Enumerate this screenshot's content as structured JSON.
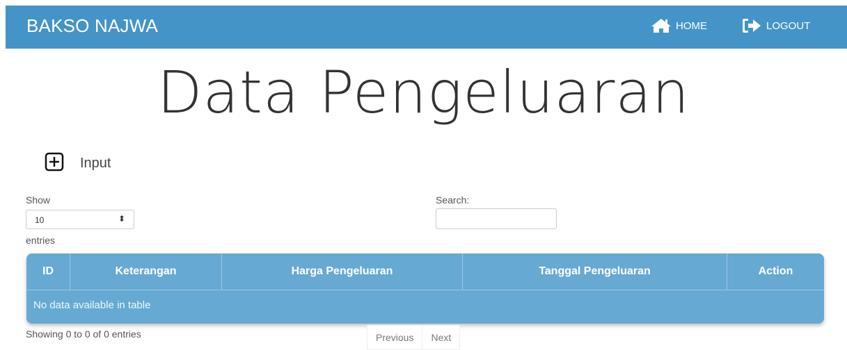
{
  "navbar": {
    "brand": "BAKSO NAJWA",
    "home_label": "HOME",
    "logout_label": "LOGOUT"
  },
  "page": {
    "title": "Data Pengeluaran",
    "input_label": "Input"
  },
  "controls": {
    "show_label": "Show",
    "page_length": "10",
    "entries_label": "entries",
    "search_label": "Search:",
    "search_value": ""
  },
  "table": {
    "columns": [
      "ID",
      "Keterangan",
      "Harga Pengeluaran",
      "Tanggal Pengeluaran",
      "Action"
    ],
    "empty_message": "No data available in table"
  },
  "footer": {
    "info": "Showing 0 to 0 of 0 entries",
    "previous": "Previous",
    "next": "Next"
  },
  "colors": {
    "navbar": "#4494c7",
    "table": "#66a9d2"
  }
}
